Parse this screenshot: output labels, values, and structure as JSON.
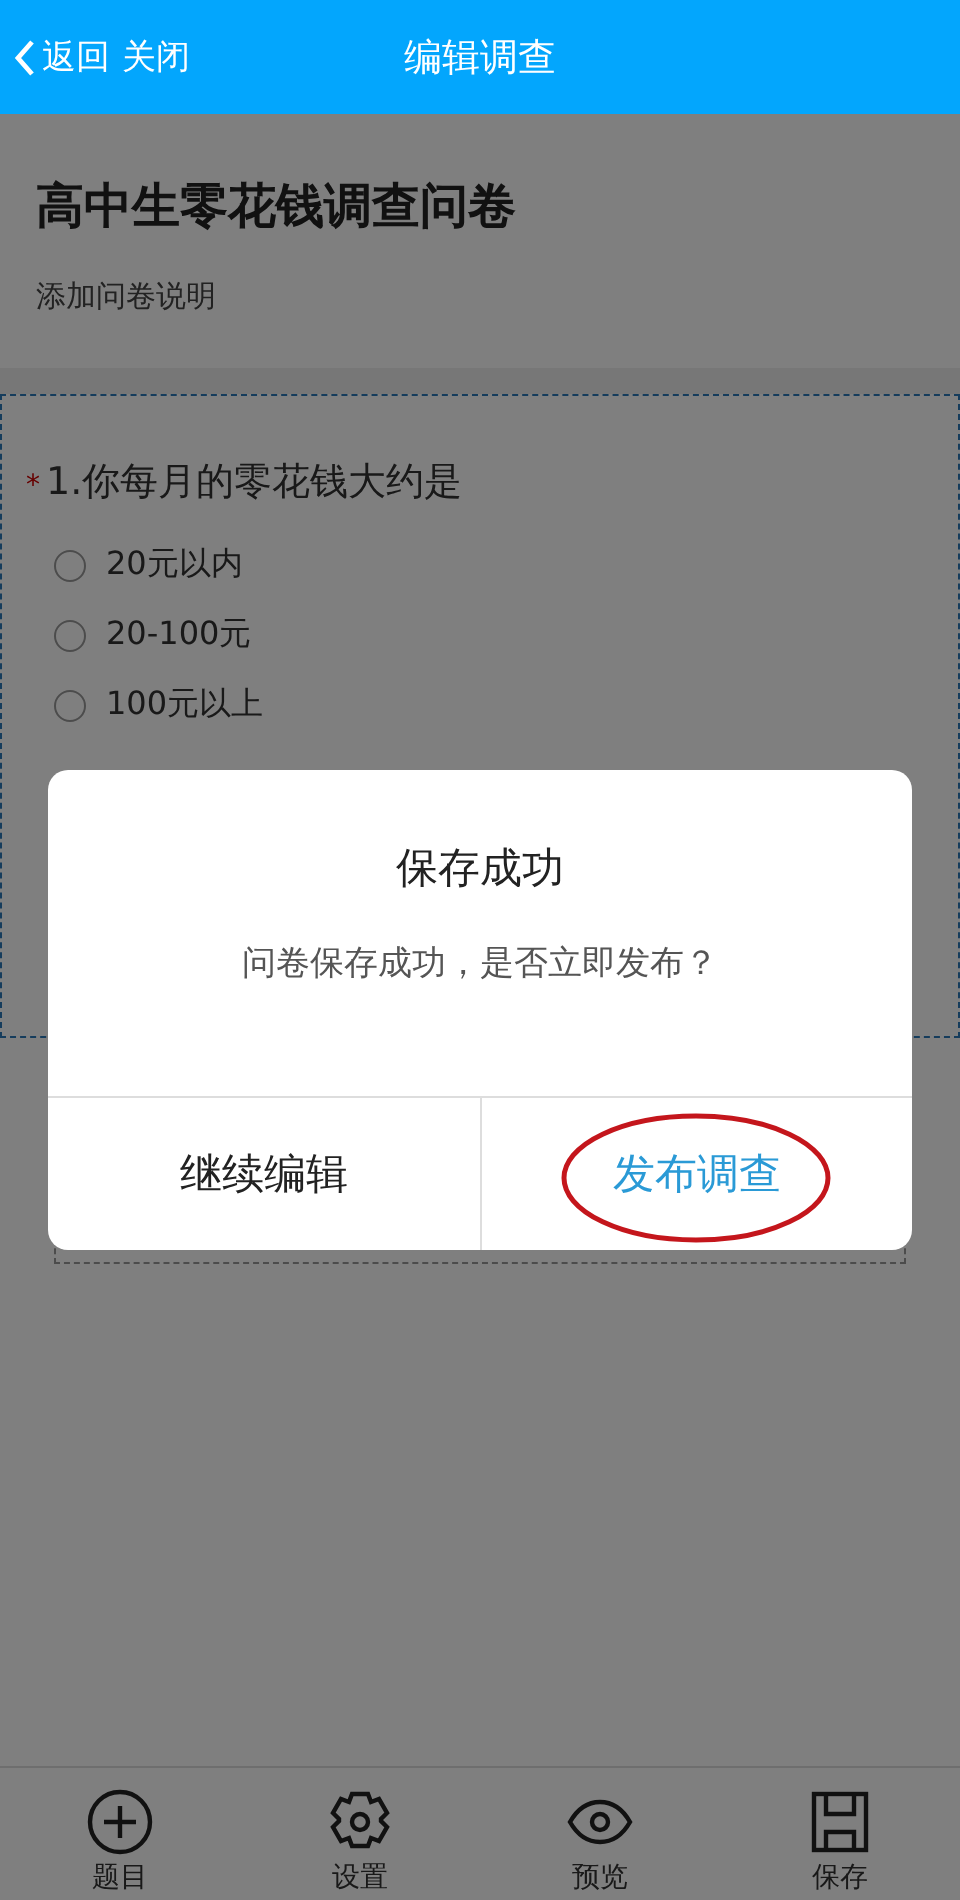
{
  "header": {
    "back": "返回",
    "close": "关闭",
    "title": "编辑调查"
  },
  "survey": {
    "title": "高中生零花钱调查问卷",
    "description": "添加问卷说明"
  },
  "questions": [
    {
      "required_mark": "*",
      "title": "1.你每月的零花钱大约是",
      "options": [
        {
          "label": "20元以内",
          "selected": false
        },
        {
          "label": "20-100元",
          "selected": false
        },
        {
          "label": "100元以上",
          "selected": false
        }
      ]
    }
  ],
  "dialog": {
    "title": "保存成功",
    "message": "问卷保存成功，是否立即发布？",
    "buttons": [
      {
        "label": "继续编辑",
        "kind": "secondary",
        "circled": false
      },
      {
        "label": "发布调查",
        "kind": "primary",
        "circled": true
      }
    ]
  },
  "toolbar": [
    {
      "label": "题目",
      "kind": "add"
    },
    {
      "label": "设置",
      "kind": "settings"
    },
    {
      "label": "预览",
      "kind": "preview"
    },
    {
      "label": "保存",
      "kind": "save"
    }
  ]
}
